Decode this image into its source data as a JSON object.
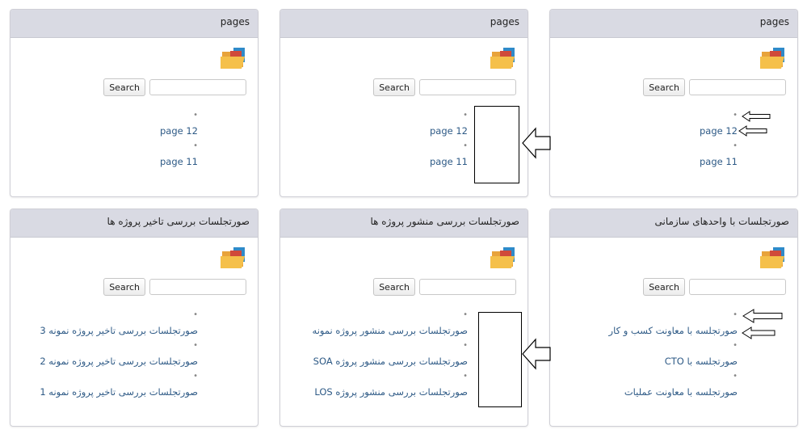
{
  "search": {
    "button_label": "Search"
  },
  "panels": [
    {
      "title": "pages",
      "links": [
        "page 12",
        "page 11"
      ]
    },
    {
      "title": "pages",
      "links": [
        "page 12",
        "page 11"
      ]
    },
    {
      "title": "pages",
      "links": [
        "page 12",
        "page 11"
      ]
    },
    {
      "title": "صورتجلسات بررسی تاخیر پروژه ها",
      "links": [
        "صورتجلسات بررسی تاخیر پروژه نمونه 3",
        "صورتجلسات بررسی تاخیر پروژه نمونه 2",
        "صورتجلسات بررسی تاخیر پروژه نمونه 1"
      ]
    },
    {
      "title": "صورتجلسات بررسی منشور پروژه ها",
      "links": [
        "صورتجلسات بررسی منشور پروژه نمونه",
        "صورتجلسات بررسی منشور پروژه SOA",
        "صورتجلسات بررسی منشور پروژه LOS"
      ]
    },
    {
      "title": "صورتجلسات با واحدهای سازمانی",
      "links": [
        "صورتجلسه با معاونت کسب و کار",
        "صورتجلسه با CTO",
        "صورتجلسه با معاونت عملیات"
      ]
    }
  ],
  "icons": {
    "panel_icon": "folder-icon",
    "annotation_arrow": "left-arrow-icon"
  },
  "colors": {
    "link": "#2e5a86",
    "header_bg": "#d9dae3"
  }
}
